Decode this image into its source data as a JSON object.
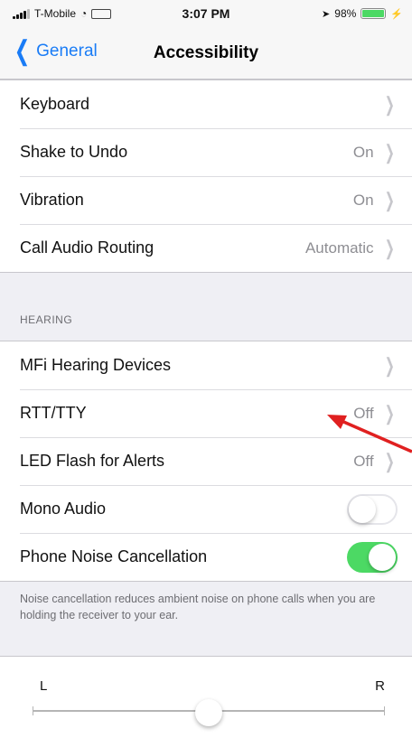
{
  "status_bar": {
    "carrier": "T-Mobile",
    "time": "3:07 PM",
    "battery": "98%",
    "battery_level": 0.98,
    "battery_color": "#4cd964"
  },
  "nav": {
    "back_label": "General",
    "title": "Accessibility"
  },
  "interaction_group": [
    {
      "label": "Keyboard",
      "value": ""
    },
    {
      "label": "Shake to Undo",
      "value": "On"
    },
    {
      "label": "Vibration",
      "value": "On"
    },
    {
      "label": "Call Audio Routing",
      "value": "Automatic"
    }
  ],
  "hearing": {
    "header": "HEARING",
    "items": [
      {
        "label": "MFi Hearing Devices",
        "value": ""
      },
      {
        "label": "RTT/TTY",
        "value": "Off"
      },
      {
        "label": "LED Flash for Alerts",
        "value": "Off"
      }
    ],
    "toggles": [
      {
        "label": "Mono Audio",
        "on": false
      },
      {
        "label": "Phone Noise Cancellation",
        "on": true
      }
    ],
    "footer": "Noise cancellation reduces ambient noise on phone calls when you are holding the receiver to your ear."
  },
  "balance": {
    "left_label": "L",
    "right_label": "R",
    "value": 0.5
  },
  "accent_color": "#1a7cf6",
  "toggle_on_color": "#4cd964",
  "annotation_arrow_color": "#e02020"
}
